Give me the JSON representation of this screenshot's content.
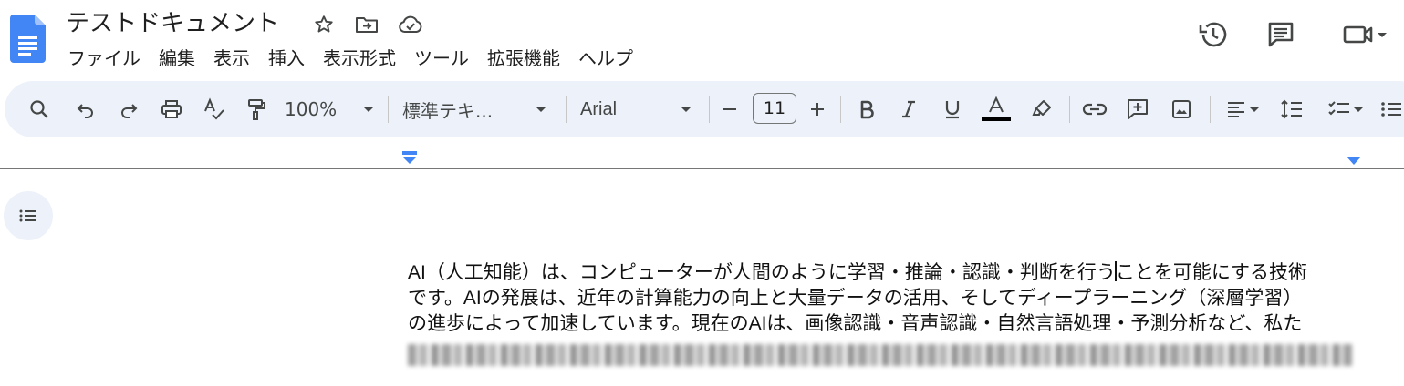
{
  "document": {
    "title": "テストドキュメント"
  },
  "menu": [
    "ファイル",
    "編集",
    "表示",
    "挿入",
    "表示形式",
    "ツール",
    "拡張機能",
    "ヘルプ"
  ],
  "header_actions": [
    "history-icon",
    "comments-icon",
    "video-call-icon"
  ],
  "toolbar": {
    "zoom": "100%",
    "paragraph_style": "標準テキ...",
    "font": "Arial",
    "font_size": "11",
    "text_color": "#000000"
  },
  "body": {
    "lines": [
      {
        "before_cursor": "AI（人工知能）は、コンピューターが人間のように学習・推論・認識・判断を行う",
        "after_cursor": "ことを可能にする技術"
      },
      {
        "text": "です。AIの発展は、近年の計算能力の向上と大量データの活用、そしてディープラーニング（深層学習）"
      },
      {
        "text": "の進歩によって加速しています。現在のAIは、画像認識・音声認識・自然言語処理・予測分析など、私た"
      }
    ]
  },
  "colors": {
    "accent": "#1a73e8",
    "toolbar_bg": "#edf2fa",
    "text": "#1f1f1f"
  }
}
